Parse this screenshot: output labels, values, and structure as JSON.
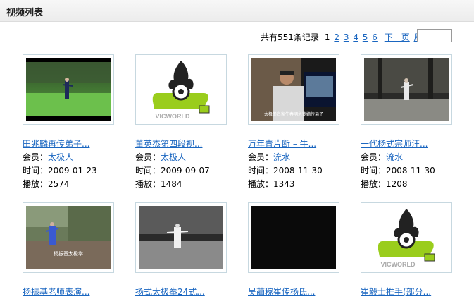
{
  "header": {
    "title": "视频列表"
  },
  "pager": {
    "summary": "一共有551条记录",
    "current": "1",
    "pages": [
      "2",
      "3",
      "4",
      "5",
      "6"
    ],
    "next": "下一页",
    "last": "尾页"
  },
  "labels": {
    "member": "会员：",
    "time": "时间：",
    "plays": "播放："
  },
  "videos": [
    {
      "title": "田兆麟再传弟子...",
      "member": "太极人",
      "time": "2009-01-23",
      "plays": "2574"
    },
    {
      "title": "董英杰第四段视...",
      "member": "太极人",
      "time": "2009-09-07",
      "plays": "1484"
    },
    {
      "title": "万年青片断 – 牛...",
      "member": "流水",
      "time": "2008-11-30",
      "plays": "1343"
    },
    {
      "title": "一代杨式宗师汪...",
      "member": "流水",
      "time": "2008-11-30",
      "plays": "1208"
    },
    {
      "title": "扬振基老师表演..."
    },
    {
      "title": "扬式太极拳24式..."
    },
    {
      "title": "吴蔺稼崔传杨氏..."
    },
    {
      "title": "崔毅士推手(部分..."
    }
  ],
  "logo_text": "VICWORLD",
  "thumb_caption_3": "太极拳名家牛春明之徒嫡传弟子",
  "thumb_caption_5": "杨振基太极拳"
}
